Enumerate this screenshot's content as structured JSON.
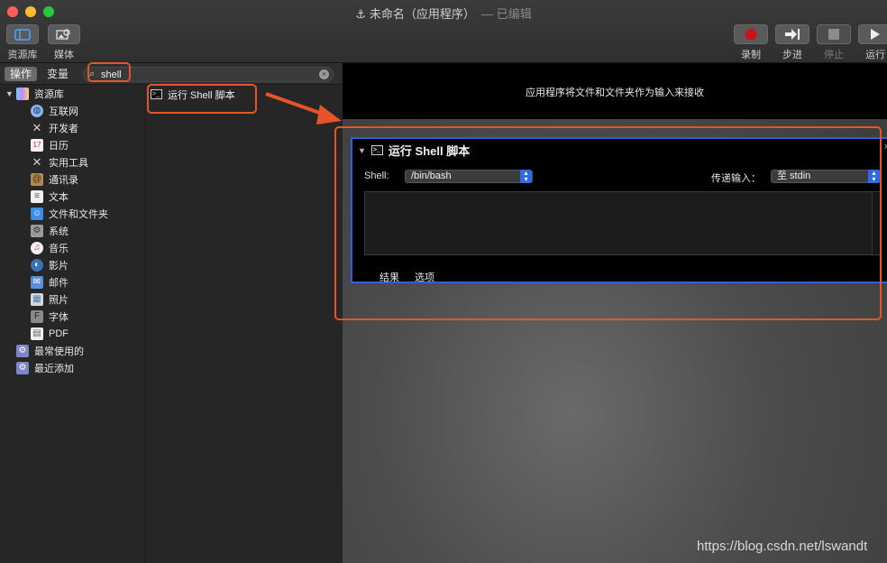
{
  "window": {
    "title": "未命名（应用程序）",
    "edited": "— 已编辑"
  },
  "toolbar": {
    "library_label": "资源库",
    "media_label": "媒体",
    "record_label": "录制",
    "step_label": "步进",
    "stop_label": "停止",
    "run_label": "运行"
  },
  "left_pane": {
    "tab_actions": "操作",
    "tab_variables": "变量",
    "search_value": "shell",
    "library_header": "资源库",
    "categories": [
      "互联网",
      "开发者",
      "日历",
      "实用工具",
      "通讯录",
      "文本",
      "文件和文件夹",
      "系统",
      "音乐",
      "影片",
      "邮件",
      "照片",
      "字体",
      "PDF"
    ],
    "most_used": "最常使用的",
    "recently_added": "最近添加",
    "result_action": "运行 Shell 脚本"
  },
  "workflow": {
    "receive_text": "应用程序将文件和文件夹作为输入来接收",
    "action_title": "运行 Shell 脚本",
    "shell_label": "Shell:",
    "shell_value": "/bin/bash",
    "pass_input_label": "传递输入：",
    "pass_input_value": "至 stdin",
    "tab_results": "结果",
    "tab_options": "选项"
  },
  "watermark": "https://blog.csdn.net/lswandt",
  "colors": {
    "accent_blue": "#2a62d8",
    "annotation_red": "#e8542a",
    "record_red": "#c4161c"
  }
}
